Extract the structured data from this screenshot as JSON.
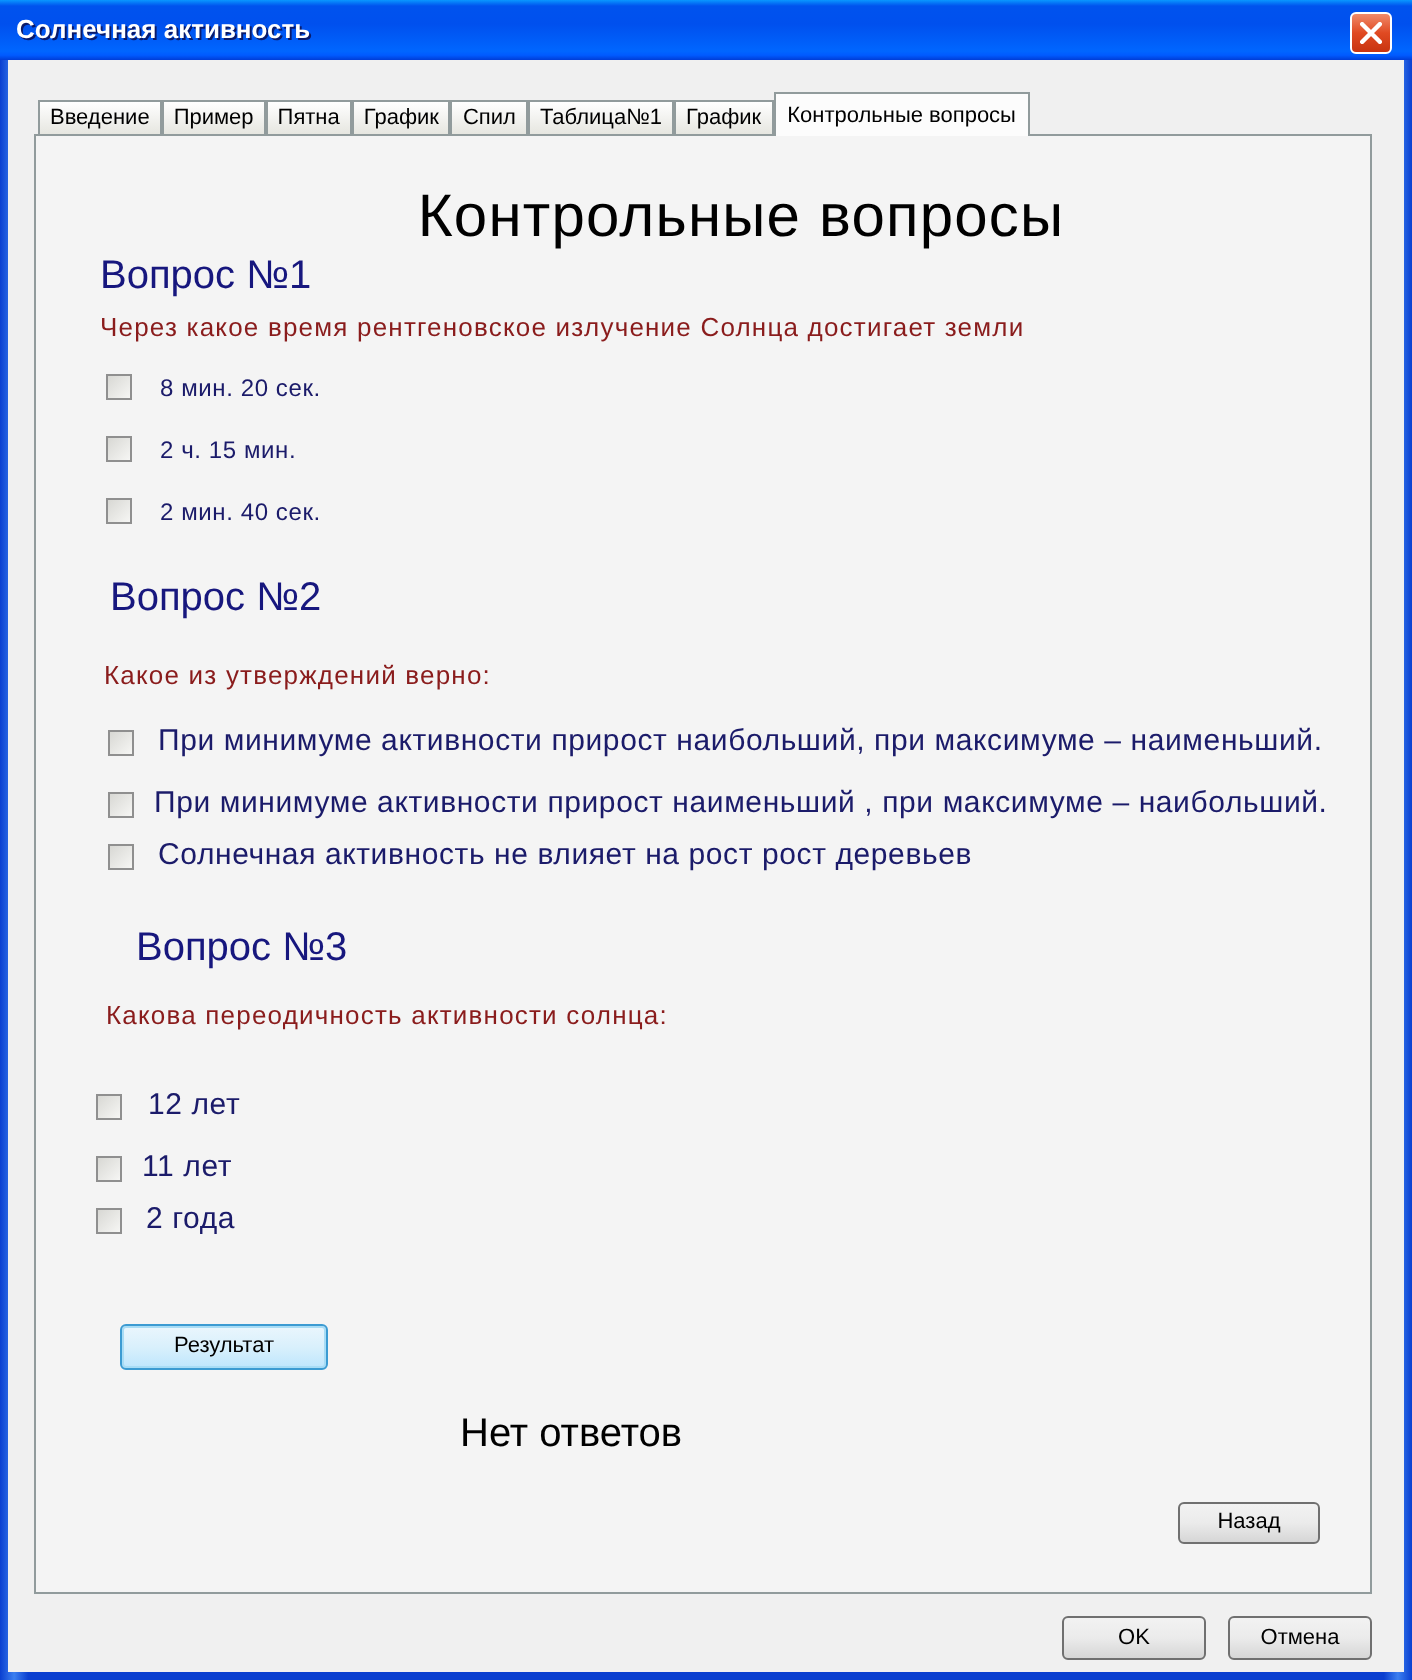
{
  "window": {
    "title": "Солнечная активность"
  },
  "tabs": [
    {
      "label": "Введение",
      "selected": false
    },
    {
      "label": "Пример",
      "selected": false
    },
    {
      "label": "Пятна",
      "selected": false
    },
    {
      "label": "График",
      "selected": false
    },
    {
      "label": "Спил",
      "selected": false
    },
    {
      "label": "Таблица№1",
      "selected": false
    },
    {
      "label": "График",
      "selected": false
    },
    {
      "label": "Контрольные вопросы",
      "selected": true
    }
  ],
  "page_title": "Контрольные вопросы",
  "questions": [
    {
      "heading": "Вопрос №1",
      "text": "Через какое время рентгеновское излучение Солнца достигает земли",
      "options": [
        {
          "label": "8 мин. 20 сек.",
          "checked": false
        },
        {
          "label": "2 ч. 15 мин.",
          "checked": false
        },
        {
          "label": "2 мин. 40 сек.",
          "checked": false
        }
      ]
    },
    {
      "heading": "Вопрос №2",
      "text": "Какое из утверждений верно:",
      "options": [
        {
          "label": "При минимуме активности прирост наибольший, при максимуме – наименьший.",
          "checked": false
        },
        {
          "label": "При минимуме активности прирост наименьший , при максимуме – наибольший.",
          "checked": false
        },
        {
          "label": "Солнечная активность не влияет на рост рост деревьев",
          "checked": false
        }
      ]
    },
    {
      "heading": "Вопрос №3",
      "text": "Какова переодичность активности солнца:",
      "options": [
        {
          "label": "12 лет",
          "checked": false
        },
        {
          "label": "11 лет",
          "checked": false
        },
        {
          "label": "2 года",
          "checked": false
        }
      ]
    }
  ],
  "result_button": "Результат",
  "result_text": "Нет ответов",
  "back_button": "Назад",
  "dialog_buttons": [
    "OK",
    "Отмена"
  ]
}
